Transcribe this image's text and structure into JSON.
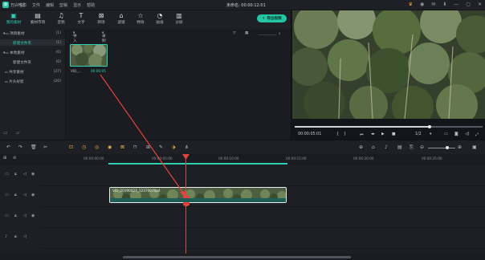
{
  "app": {
    "name": "万兴喵影",
    "logo_glyph": "✿",
    "document_title": "未命名: 00:00:12:01"
  },
  "menu": [
    "文件",
    "编辑",
    "剪辑",
    "显示",
    "帮助"
  ],
  "toolbar": {
    "tools": [
      {
        "label": "我的素材",
        "icon": "media-icon"
      },
      {
        "label": "素材市场",
        "icon": "market-icon"
      },
      {
        "label": "音频",
        "icon": "music-icon"
      },
      {
        "label": "文字",
        "icon": "text-icon"
      },
      {
        "label": "转场",
        "icon": "transition-icon"
      },
      {
        "label": "滤镜",
        "icon": "filter-icon"
      },
      {
        "label": "特效",
        "icon": "effects-icon"
      },
      {
        "label": "贴纸",
        "icon": "sticker-icon"
      },
      {
        "label": "分屏",
        "icon": "split-screen-icon"
      }
    ],
    "export_label": "导出视频"
  },
  "left_panel": {
    "items": [
      {
        "label": "项目素材",
        "count": "(1)"
      },
      {
        "label": "新建文件夹",
        "count": "(1)"
      },
      {
        "label": "本地素材",
        "count": "(0)"
      },
      {
        "label": "新建文件夹",
        "count": "(0)"
      },
      {
        "label": "共享素材",
        "count": "(27)"
      },
      {
        "label": "片头好剪",
        "count": "(20)"
      }
    ]
  },
  "media": {
    "import_label": "导入",
    "record_label": "录制",
    "clip_name": "VID_…",
    "clip_duration": "00:00:05"
  },
  "preview": {
    "current_time": "00:00:05:01",
    "ratio": "1/2",
    "progress_fraction": 0.72
  },
  "timeline": {
    "ruler_labels": [
      "00:00:00:00",
      "00:00:05:00",
      "00:00:10:00",
      "00:00:15:00",
      "00:00:20:00",
      "00:00:25:00"
    ],
    "clip_label": "VID_20190427_123700.mp4"
  },
  "colors": {
    "accent": "#2fd1b4",
    "playhead": "#e0443c",
    "export": "#22c7a6"
  }
}
